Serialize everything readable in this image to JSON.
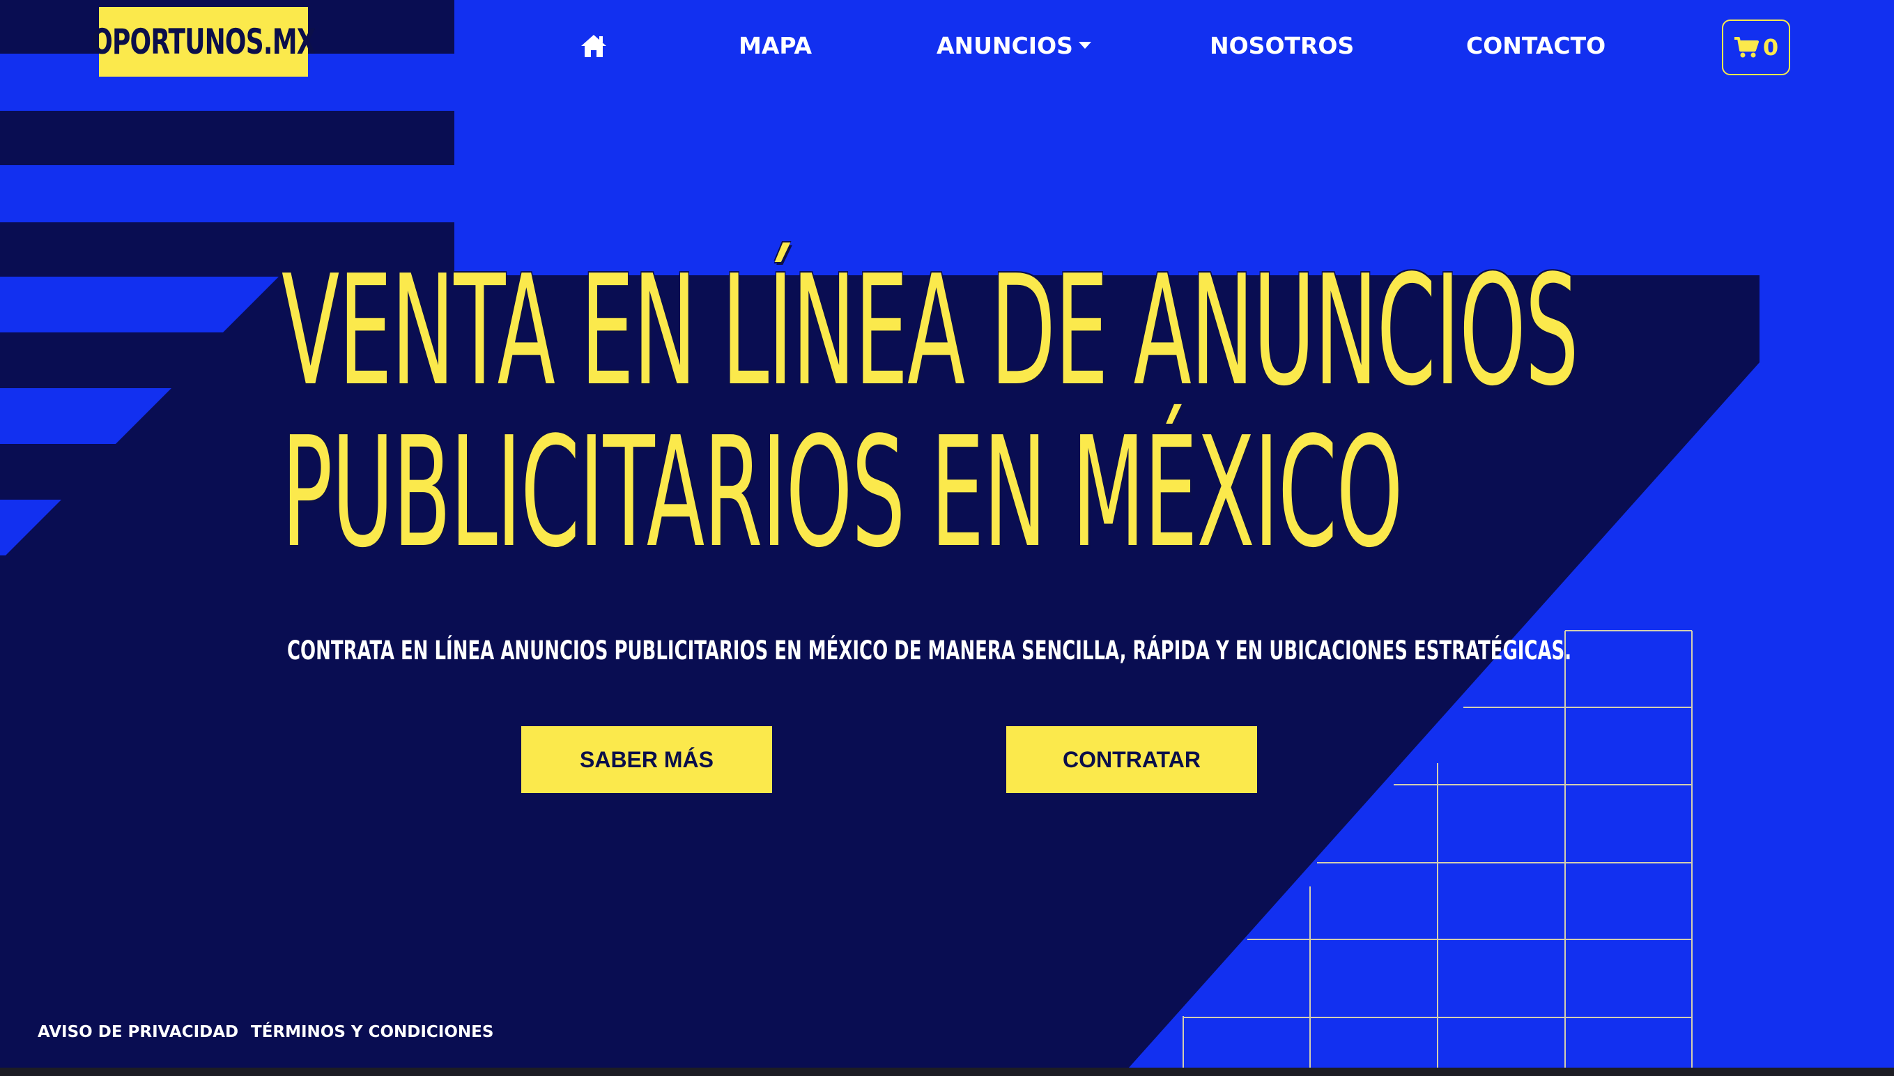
{
  "brand": {
    "logo_text": "OPORTUNOS.MX"
  },
  "nav": {
    "home_icon": "home-icon",
    "items": [
      {
        "label": "MAPA"
      },
      {
        "label": "ANUNCIOS",
        "has_dropdown": true
      },
      {
        "label": "NOSOTROS"
      },
      {
        "label": "CONTACTO"
      }
    ],
    "cart": {
      "icon": "cart-icon",
      "count": "0"
    }
  },
  "hero": {
    "headline_line1": "VENTA EN LÍNEA DE ANUNCIOS",
    "headline_line2": "PUBLICITARIOS EN MÉXICO",
    "subtitle": "CONTRATA EN LÍNEA ANUNCIOS PUBLICITARIOS EN MÉXICO DE MANERA SENCILLA, RÁPIDA Y EN UBICACIONES ESTRATÉGICAS.",
    "buttons": [
      {
        "label": "SABER MÁS"
      },
      {
        "label": "CONTRATAR"
      }
    ]
  },
  "footer": {
    "links": [
      {
        "label": "AVISO DE PRIVACIDAD"
      },
      {
        "label": "TÉRMINOS Y CONDICIONES"
      }
    ]
  },
  "colors": {
    "bright_blue": "#1230f0",
    "dark_navy": "#090d52",
    "yellow": "#fbe94c",
    "white": "#ffffff"
  }
}
